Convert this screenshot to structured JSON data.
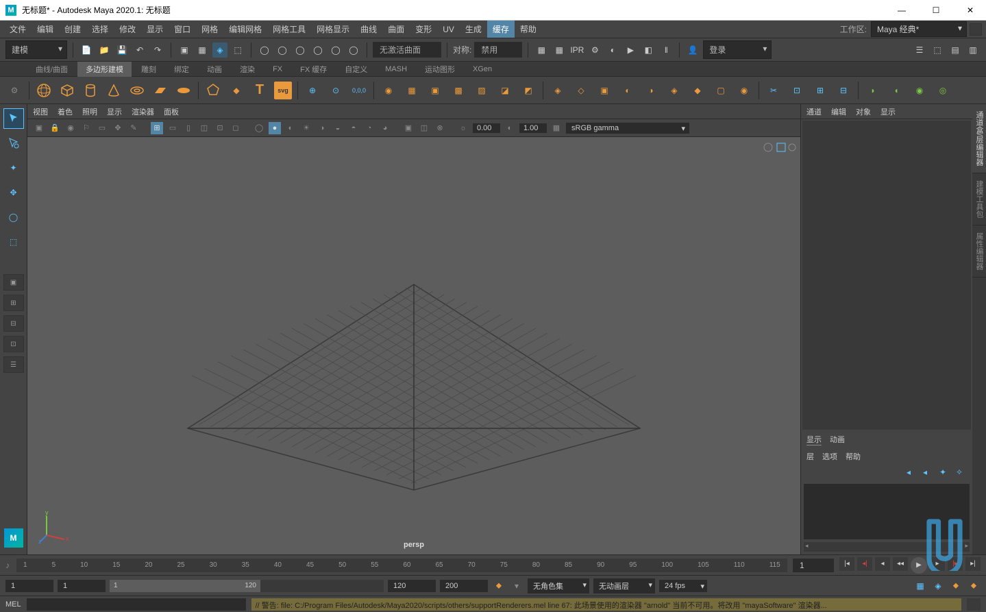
{
  "window": {
    "title": "无标题* - Autodesk Maya 2020.1: 无标题",
    "logo": "M"
  },
  "menu": {
    "items": [
      "文件",
      "编辑",
      "创建",
      "选择",
      "修改",
      "显示",
      "窗口",
      "网格",
      "编辑网格",
      "网格工具",
      "网格显示",
      "曲线",
      "曲面",
      "变形",
      "UV",
      "生成",
      "缓存",
      "帮助"
    ],
    "active": 16
  },
  "workspace": {
    "label": "工作区:",
    "value": "Maya 经典*"
  },
  "toolbar": {
    "mode": "建模",
    "curve_status": "无激活曲面",
    "sym_label": "对称:",
    "sym_value": "禁用",
    "login": "登录"
  },
  "shelftabs": {
    "items": [
      "曲线/曲面",
      "多边形建模",
      "雕刻",
      "绑定",
      "动画",
      "渲染",
      "FX",
      "FX 缓存",
      "自定义",
      "MASH",
      "运动图形",
      "XGen"
    ],
    "active": 1
  },
  "viewport": {
    "menu": [
      "视图",
      "着色",
      "照明",
      "显示",
      "渲染器",
      "面板"
    ],
    "val1": "0.00",
    "val2": "1.00",
    "colorspace": "sRGB gamma",
    "camera": "persp"
  },
  "channelbox": {
    "tabs": [
      "通道",
      "编辑",
      "对象",
      "显示"
    ]
  },
  "layers": {
    "tabs_top": [
      "显示",
      "动画"
    ],
    "tabs_bot": [
      "层",
      "选项",
      "帮助"
    ]
  },
  "sidetabs": {
    "items": [
      "通道盒/层编辑器",
      "建模工具包",
      "属性编辑器"
    ],
    "active": 0
  },
  "timeline": {
    "ticks": [
      "1",
      "5",
      "10",
      "15",
      "20",
      "25",
      "30",
      "35",
      "40",
      "45",
      "50",
      "55",
      "60",
      "65",
      "70",
      "75",
      "80",
      "85",
      "90",
      "95",
      "100",
      "105",
      "110",
      "115"
    ],
    "current": "1"
  },
  "range": {
    "start": "1",
    "start2": "1",
    "slider_a": "1",
    "slider_b": "120",
    "end": "120",
    "end2": "200",
    "charset": "无角色集",
    "animlayer": "无动画层",
    "fps": "24 fps"
  },
  "cmd": {
    "lang": "MEL",
    "output": "// 警告: file: C:/Program Files/Autodesk/Maya2020/scripts/others/supportRenderers.mel line 67: 此场景使用的渲染器 \"arnold\" 当前不可用。将改用 \"mayaSoftware\" 渲染器..."
  }
}
